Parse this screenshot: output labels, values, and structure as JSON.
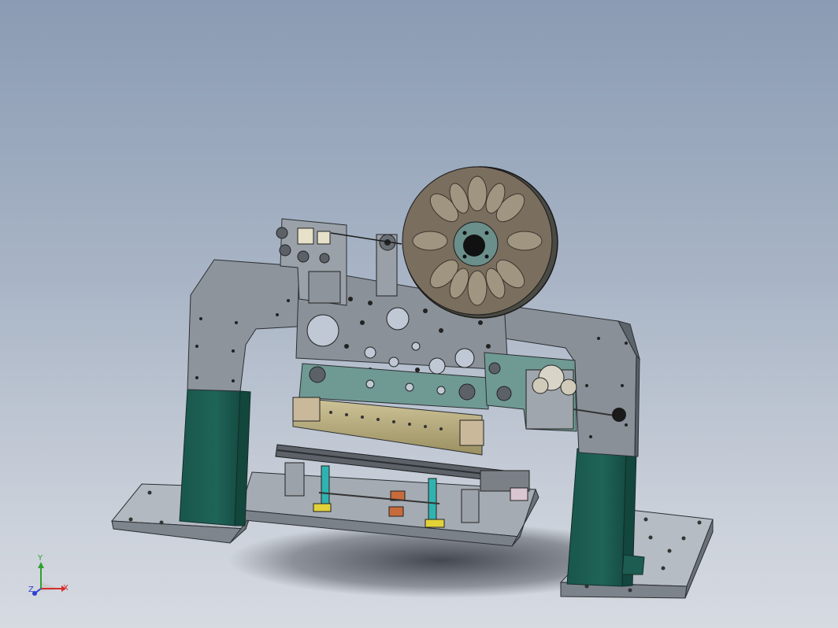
{
  "view": {
    "background_top": "#8a9bb3",
    "background_bottom": "#d6dae1"
  },
  "model": {
    "frame_color": "#8e949c",
    "leg_color": "#1f6458",
    "plate_color": "#a7adb4",
    "reel_color": "#7a6e5f",
    "brass_color": "#b9ad7c"
  },
  "triad": {
    "x_label": "X",
    "y_label": "Y",
    "z_label": "Z",
    "x_color": "#d62c2c",
    "y_color": "#2fa12f",
    "z_color": "#2e3fd1"
  }
}
